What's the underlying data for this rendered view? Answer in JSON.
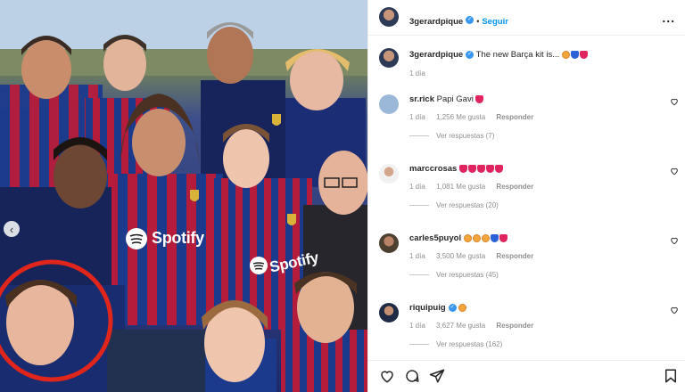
{
  "post": {
    "author": "3gerardpique",
    "follow_label": "Seguir",
    "separator": "•",
    "caption": "The new Barça kit is...",
    "caption_time": "1 día",
    "more_label": "..."
  },
  "photo": {
    "sponsor_text": "Spotify",
    "nav_prev_icon": "chevron-left-icon"
  },
  "comments": [
    {
      "user": "sr.rick",
      "text": "Papi Gavi",
      "emojis": [
        "red-heart"
      ],
      "time": "1 día",
      "likes": "1,256 Me gusta",
      "reply_label": "Responder",
      "replies": "Ver respuestas (7)",
      "verified": false
    },
    {
      "user": "marccrosas",
      "text": "",
      "emojis": [
        "red-heart",
        "red-heart",
        "red-heart",
        "red-heart",
        "red-heart"
      ],
      "time": "1 día",
      "likes": "1,081 Me gusta",
      "reply_label": "Responder",
      "replies": "Ver respuestas (20)",
      "verified": false
    },
    {
      "user": "carles5puyol",
      "text": "",
      "emojis": [
        "heart-eyes-face",
        "heart-eyes-face",
        "heart-eyes-face",
        "blue-heart",
        "red-heart"
      ],
      "time": "1 día",
      "likes": "3,500 Me gusta",
      "reply_label": "Responder",
      "replies": "Ver respuestas (45)",
      "verified": false
    },
    {
      "user": "riquipuig",
      "text": "",
      "emojis": [
        "heart-eyes-face"
      ],
      "time": "1 día",
      "likes": "3,627 Me gusta",
      "reply_label": "Responder",
      "replies": "Ver respuestas (162)",
      "verified": true
    }
  ],
  "colors": {
    "accent": "#0095f6",
    "verified": "#3897f0",
    "circle": "#e0261c",
    "barca_blue": "#1b3a8c",
    "barca_red": "#b51b3b"
  },
  "icons": {
    "like": "heart-outline-icon",
    "comment": "comment-icon",
    "share": "paper-plane-icon",
    "save": "bookmark-icon",
    "comment_like": "small-heart-icon"
  }
}
